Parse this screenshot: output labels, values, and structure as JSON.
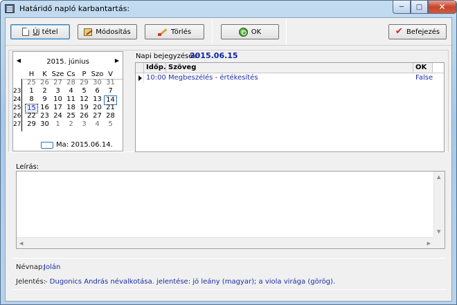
{
  "window": {
    "title": "Határidő napló karbantartás:",
    "icon": "app-icon",
    "controls": [
      "minimize",
      "maximize",
      "close"
    ]
  },
  "toolbar": {
    "new_label": "Új tétel",
    "edit_label": "Módosítás",
    "delete_label": "Törlés",
    "ok_label": "OK",
    "finish_label": "Befejezés"
  },
  "calendar": {
    "month_title": "2015. június",
    "weekdays": [
      "H",
      "K",
      "Sze",
      "Cs",
      "P",
      "Szo",
      "V"
    ],
    "weeks": [
      {
        "wk": "",
        "days": [
          "25",
          "26",
          "27",
          "28",
          "29",
          "30",
          "31"
        ]
      },
      {
        "wk": "23",
        "days": [
          "1",
          "2",
          "3",
          "4",
          "5",
          "6",
          "7"
        ]
      },
      {
        "wk": "24",
        "days": [
          "8",
          "9",
          "10",
          "11",
          "12",
          "13",
          "14"
        ]
      },
      {
        "wk": "25",
        "days": [
          "15",
          "16",
          "17",
          "18",
          "19",
          "20",
          "21"
        ]
      },
      {
        "wk": "26",
        "days": [
          "22",
          "23",
          "24",
          "25",
          "26",
          "27",
          "28"
        ]
      },
      {
        "wk": "27",
        "days": [
          "29",
          "30",
          "1",
          "2",
          "3",
          "4",
          "5"
        ]
      }
    ],
    "today_label": "Ma: 2015.06.14.",
    "selected_day": "15",
    "today_day": "14"
  },
  "entries": {
    "label": "Napi bejegyzések:",
    "date": "2015.06.15",
    "columns": [
      "Időp.",
      "Szöveg",
      "OK"
    ],
    "rows": [
      {
        "time": "10:00",
        "text": "Megbeszélés - értékesítés",
        "ok": "False"
      }
    ]
  },
  "description": {
    "label": "Leírás:",
    "value": ""
  },
  "nevnap": {
    "label": "Névnap:",
    "value": "Jolán"
  },
  "jelentes": {
    "label": "Jelentés:",
    "value": "- Dugonics András névalkotása. jelentése: jó leány (magyar); a viola virága (görög)."
  },
  "colors": {
    "accent_blue": "#1b2ea8",
    "date_blue": "#0d22a5",
    "close_red": "#c6452c"
  }
}
